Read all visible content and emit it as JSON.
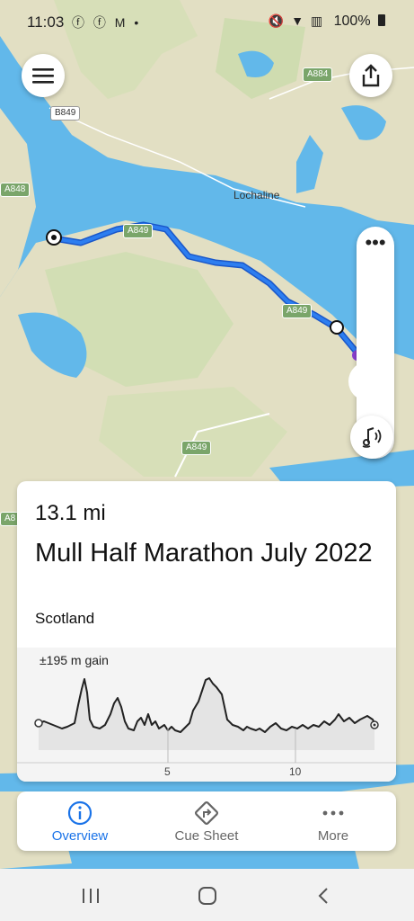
{
  "status": {
    "time": "11:03",
    "left_icons": "ⓕ ⓕ M •",
    "right_icons": "🔇 ▼ ▥",
    "battery": "100%"
  },
  "map": {
    "place_label": "Lochaline",
    "road_labels": [
      "A849",
      "A849",
      "A849",
      "A884",
      "B849",
      "A848",
      "A8"
    ]
  },
  "buttons": {
    "menu_icon": "menu-icon",
    "share_icon": "share-icon",
    "more_icon": "more-horizontal-icon",
    "audio_icon": "audio-cue-icon"
  },
  "route": {
    "distance": "13.1 mi",
    "title": "Mull Half Marathon July 2022",
    "region": "Scotland",
    "elevation_gain": "±195 m gain",
    "elevation_ticks": [
      "5",
      "10"
    ]
  },
  "tabs": [
    {
      "label": "Overview",
      "icon": "info-icon",
      "active": true
    },
    {
      "label": "Cue Sheet",
      "icon": "turn-right-icon",
      "active": false
    },
    {
      "label": "More",
      "icon": "more-horizontal-icon",
      "active": false
    }
  ],
  "system_nav": {
    "recents_icon": "recents-icon",
    "home_icon": "home-icon",
    "back_icon": "back-icon"
  }
}
